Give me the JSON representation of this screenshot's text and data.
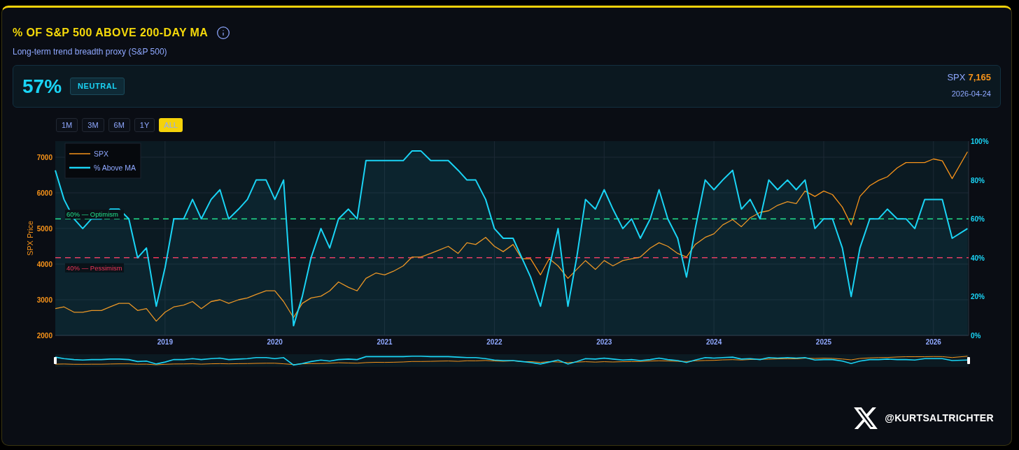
{
  "header": {
    "title": "% OF S&P 500 ABOVE 200-DAY MA",
    "subtitle": "Long-term trend breadth proxy (S&P 500)"
  },
  "summary": {
    "value": "57%",
    "status": "NEUTRAL",
    "index_label": "SPX",
    "index_value": "7,165",
    "date": "2026-04-24"
  },
  "ranges": [
    {
      "label": "1M",
      "selected": false
    },
    {
      "label": "3M",
      "selected": false
    },
    {
      "label": "6M",
      "selected": false
    },
    {
      "label": "1Y",
      "selected": false
    },
    {
      "label": "ALL",
      "selected": true
    }
  ],
  "chart": {
    "chart_data": {
      "type": "line",
      "ylabel": "SPX Price",
      "xlim": [
        2018.0,
        2026.32
      ],
      "ylim": [
        2000,
        7450
      ],
      "y2lim": [
        0,
        100
      ],
      "xticks": [
        2019,
        2020,
        2021,
        2022,
        2023,
        2024,
        2025,
        2026
      ],
      "yticks": [
        2000,
        3000,
        4000,
        5000,
        6000,
        7000
      ],
      "y2ticks": [
        {
          "value": 0,
          "label": "0%"
        },
        {
          "value": 20,
          "label": "20%"
        },
        {
          "value": 40,
          "label": "40%"
        },
        {
          "value": 60,
          "label": "60%"
        },
        {
          "value": 80,
          "label": "80%"
        },
        {
          "value": 100,
          "label": "100%"
        }
      ],
      "x": [
        2018.0,
        2018.08,
        2018.17,
        2018.25,
        2018.33,
        2018.42,
        2018.5,
        2018.58,
        2018.67,
        2018.75,
        2018.83,
        2018.92,
        2019.0,
        2019.08,
        2019.17,
        2019.25,
        2019.33,
        2019.42,
        2019.5,
        2019.58,
        2019.67,
        2019.75,
        2019.83,
        2019.92,
        2020.0,
        2020.08,
        2020.17,
        2020.25,
        2020.33,
        2020.42,
        2020.5,
        2020.58,
        2020.67,
        2020.75,
        2020.83,
        2020.92,
        2021.0,
        2021.08,
        2021.17,
        2021.25,
        2021.33,
        2021.42,
        2021.5,
        2021.58,
        2021.67,
        2021.75,
        2021.83,
        2021.92,
        2022.0,
        2022.08,
        2022.17,
        2022.25,
        2022.33,
        2022.42,
        2022.5,
        2022.58,
        2022.67,
        2022.75,
        2022.83,
        2022.92,
        2023.0,
        2023.08,
        2023.17,
        2023.25,
        2023.33,
        2023.42,
        2023.5,
        2023.58,
        2023.67,
        2023.75,
        2023.83,
        2023.92,
        2024.0,
        2024.08,
        2024.17,
        2024.25,
        2024.33,
        2024.42,
        2024.5,
        2024.58,
        2024.67,
        2024.75,
        2024.83,
        2024.92,
        2025.0,
        2025.08,
        2025.17,
        2025.25,
        2025.33,
        2025.42,
        2025.5,
        2025.58,
        2025.67,
        2025.75,
        2025.83,
        2025.92,
        2026.0,
        2026.08,
        2026.17,
        2026.31
      ],
      "series": [
        {
          "name": "SPX",
          "color": "#f7931a",
          "values": [
            2750,
            2800,
            2650,
            2650,
            2700,
            2700,
            2800,
            2900,
            2900,
            2700,
            2750,
            2400,
            2650,
            2800,
            2850,
            2950,
            2750,
            2950,
            3000,
            2900,
            3000,
            3050,
            3150,
            3250,
            3250,
            2950,
            2500,
            2900,
            3050,
            3100,
            3250,
            3500,
            3350,
            3250,
            3600,
            3750,
            3700,
            3800,
            3950,
            4200,
            4200,
            4300,
            4400,
            4500,
            4300,
            4600,
            4550,
            4750,
            4500,
            4350,
            4550,
            4150,
            4150,
            3700,
            4150,
            3950,
            3600,
            3850,
            4100,
            3850,
            4100,
            3950,
            4100,
            4150,
            4200,
            4450,
            4600,
            4500,
            4300,
            4200,
            4550,
            4750,
            4850,
            5100,
            5250,
            5050,
            5300,
            5450,
            5500,
            5650,
            5750,
            5700,
            6050,
            5900,
            6050,
            5950,
            5600,
            5100,
            5900,
            6200,
            6350,
            6450,
            6700,
            6850,
            6850,
            6850,
            6950,
            6900,
            6400,
            7150
          ]
        },
        {
          "name": "% Above MA",
          "color": "#1ad4f5",
          "axis": "y2",
          "type": "area",
          "values": [
            85,
            70,
            60,
            55,
            60,
            60,
            65,
            65,
            60,
            40,
            45,
            15,
            35,
            60,
            60,
            70,
            60,
            70,
            75,
            60,
            65,
            70,
            80,
            80,
            70,
            80,
            5,
            20,
            40,
            55,
            45,
            60,
            65,
            60,
            90,
            90,
            90,
            90,
            90,
            95,
            95,
            90,
            90,
            90,
            85,
            80,
            80,
            70,
            55,
            50,
            50,
            40,
            30,
            15,
            35,
            55,
            15,
            40,
            70,
            65,
            75,
            65,
            55,
            60,
            50,
            60,
            75,
            60,
            50,
            30,
            55,
            80,
            75,
            80,
            85,
            65,
            70,
            60,
            80,
            75,
            80,
            75,
            80,
            55,
            60,
            60,
            45,
            20,
            45,
            60,
            60,
            65,
            60,
            60,
            55,
            70,
            70,
            70,
            50,
            55
          ]
        }
      ],
      "ref_lines": [
        {
          "label": "60% — Optimism",
          "axis": "y2",
          "value": 60,
          "color": "#22e08a"
        },
        {
          "label": "40% — Pessimism",
          "axis": "y2",
          "value": 40,
          "color": "#f0365a"
        }
      ],
      "grid": true,
      "legend": "upper left"
    }
  },
  "footer": {
    "handle": "@KURTSALTRICHTER"
  }
}
